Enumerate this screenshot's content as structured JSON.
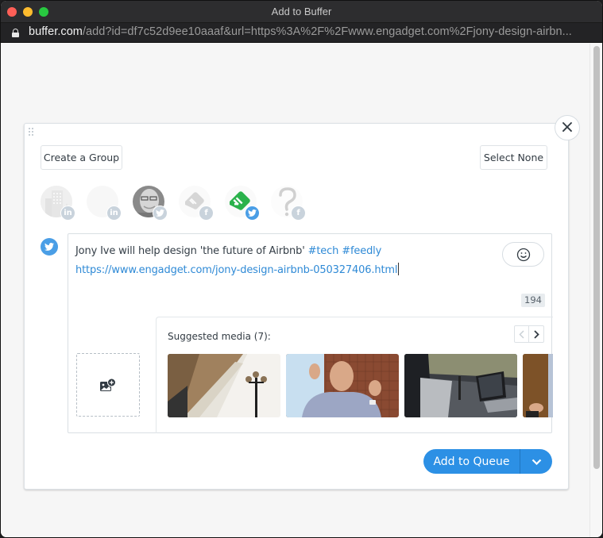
{
  "window": {
    "title": "Add to Buffer",
    "url_host": "buffer.com",
    "url_path": "/add?id=df7c52d9ee10aaaf&url=https%3A%2F%2Fwww.engadget.com%2Fjony-design-airbn..."
  },
  "toolbar": {
    "create_group_label": "Create a Group",
    "select_none_label": "Select None",
    "close_label": "×"
  },
  "profiles": [
    {
      "network": "linkedin",
      "badge": "in",
      "avatar": "building-avatar",
      "selected": false
    },
    {
      "network": "linkedin",
      "badge": "in",
      "avatar": "blank-avatar",
      "selected": false
    },
    {
      "network": "twitter",
      "badge": "twitter-bird",
      "avatar": "person-avatar",
      "selected": false
    },
    {
      "network": "facebook",
      "badge": "f",
      "avatar": "feedly-grey-avatar",
      "selected": false
    },
    {
      "network": "twitter",
      "badge": "twitter-bird",
      "avatar": "feedly-green-avatar",
      "selected": true
    },
    {
      "network": "facebook",
      "badge": "f",
      "avatar": "question-avatar",
      "selected": false
    }
  ],
  "composer": {
    "network": "twitter",
    "text": "Jony Ive will help design 'the future of Airbnb' ",
    "hashtags": "#tech #feedly",
    "link": "https://www.engadget.com/jony-design-airbnb-050327406.html",
    "char_count": "194",
    "emoji_icon": "smiley-icon",
    "add_media_icon": "image-plus-icon"
  },
  "suggested_media": {
    "title": "Suggested media (7):",
    "count": 7,
    "thumbnails": [
      {
        "name": "twitter-building-photo"
      },
      {
        "name": "jony-ive-photo"
      },
      {
        "name": "car-interior-photo"
      },
      {
        "name": "partial-photo"
      }
    ]
  },
  "actions": {
    "add_to_queue_label": "Add to Queue"
  },
  "colors": {
    "accent": "#2c90e5",
    "twitter_blue": "#4a9ee6",
    "link_blue": "#2f8ad6",
    "feedly_green": "#2bb24c"
  }
}
